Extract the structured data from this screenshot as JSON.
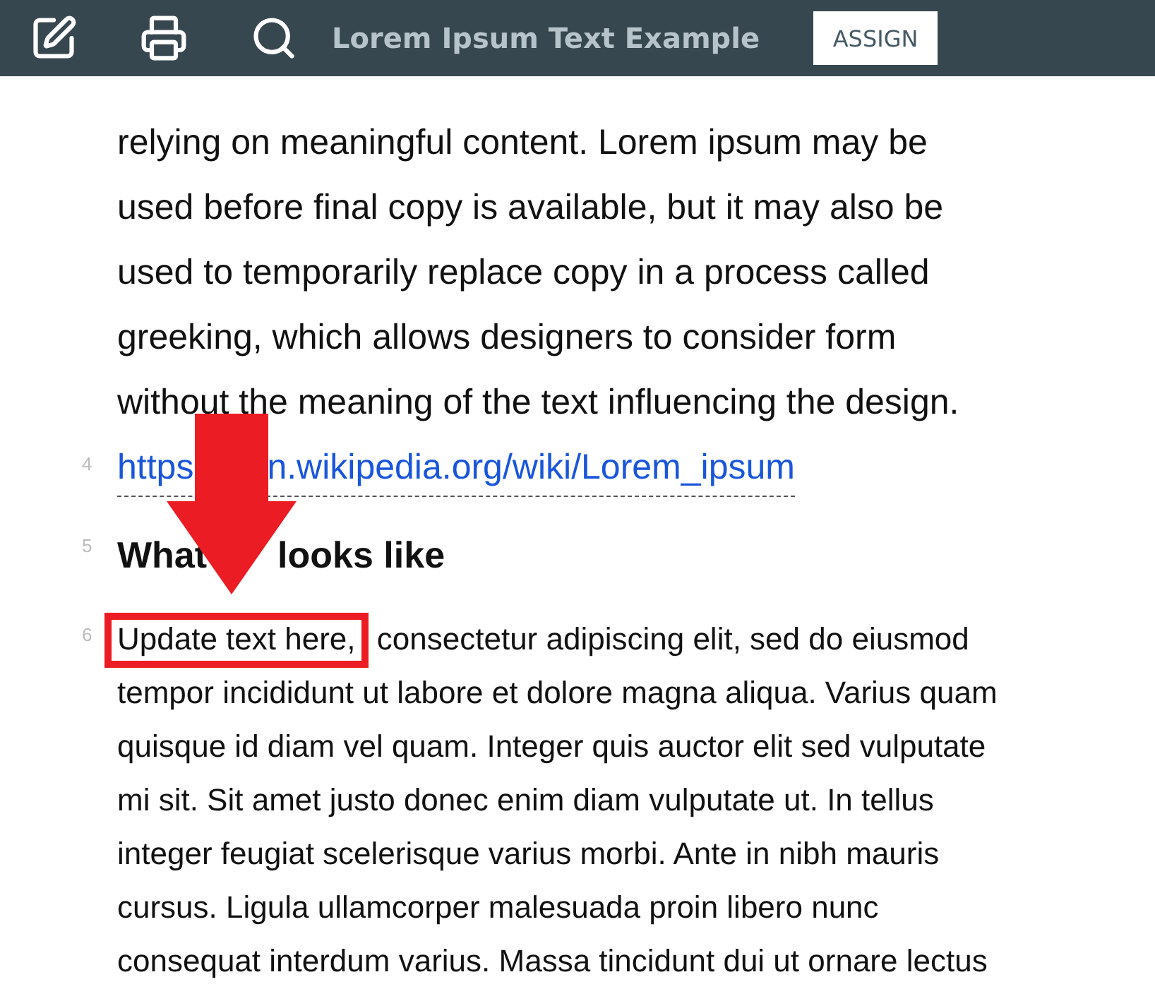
{
  "toolbar": {
    "title": "Lorem Ipsum Text Example",
    "assign_button": "ASSIGN"
  },
  "blocks": [
    {
      "kind": "paragraph",
      "lines": [
        "relying on meaningful content. Lorem ipsum may be",
        "used before final copy is available, but it may also be",
        "used to temporarily replace copy in a process called",
        "greeking, which allows designers to consider form",
        "without the meaning of the text influencing the design."
      ]
    },
    {
      "kind": "link",
      "number": "4",
      "parts": [
        "https",
        "n.wikipedia.org/wiki/Lorem_ipsum"
      ]
    },
    {
      "kind": "heading",
      "number": "5",
      "parts": [
        "What",
        "looks like"
      ]
    },
    {
      "kind": "body",
      "number": "6",
      "highlighted": "Update text here,",
      "lines": [
        "consectetur adipiscing elit, sed do eiusmod",
        "tempor incididunt ut labore et dolore magna aliqua. Varius quam",
        "quisque id diam vel quam. Integer quis auctor elit sed vulputate",
        "mi sit. Sit amet justo donec enim diam vulputate ut. In tellus",
        "integer feugiat scelerisque varius morbi. Ante in nibh mauris",
        "cursus. Ligula ullamcorper malesuada proin libero nunc",
        "consequat interdum varius. Massa tincidunt dui ut ornare lectus"
      ]
    }
  ]
}
